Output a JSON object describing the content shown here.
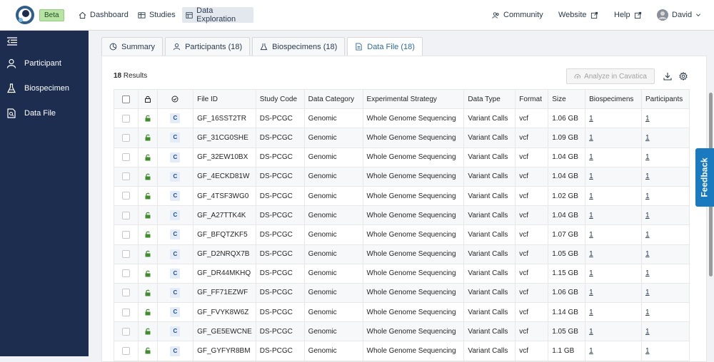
{
  "header": {
    "beta": "Beta",
    "nav": [
      {
        "label": "Dashboard"
      },
      {
        "label": "Studies"
      },
      {
        "label": "Data Exploration"
      }
    ],
    "right": {
      "community": "Community",
      "website": "Website",
      "help": "Help",
      "user": "David"
    }
  },
  "sidebar": {
    "items": [
      {
        "label": "Participant"
      },
      {
        "label": "Biospecimen"
      },
      {
        "label": "Data File"
      }
    ]
  },
  "tabs": [
    {
      "label": "Summary"
    },
    {
      "label": "Participants (18)"
    },
    {
      "label": "Biospecimens (18)"
    },
    {
      "label": "Data File (18)"
    }
  ],
  "toolbar": {
    "results_count": "18",
    "results_label": " Results",
    "cavatica": "Analyze in Cavatica"
  },
  "table": {
    "columns": [
      "File ID",
      "Study Code",
      "Data Category",
      "Experimental Strategy",
      "Data Type",
      "Format",
      "Size",
      "Biospecimens",
      "Participants"
    ],
    "rows": [
      {
        "id": "GF_16SST2TR",
        "study": "DS-PCGC",
        "cat": "Genomic",
        "strategy": "Whole Genome Sequencing",
        "type": "Variant Calls",
        "format": "vcf",
        "size": "1.06 GB",
        "bio": "1",
        "part": "1"
      },
      {
        "id": "GF_31CG0SHE",
        "study": "DS-PCGC",
        "cat": "Genomic",
        "strategy": "Whole Genome Sequencing",
        "type": "Variant Calls",
        "format": "vcf",
        "size": "1.09 GB",
        "bio": "1",
        "part": "1"
      },
      {
        "id": "GF_32EW10BX",
        "study": "DS-PCGC",
        "cat": "Genomic",
        "strategy": "Whole Genome Sequencing",
        "type": "Variant Calls",
        "format": "vcf",
        "size": "1.04 GB",
        "bio": "1",
        "part": "1"
      },
      {
        "id": "GF_4ECKD81W",
        "study": "DS-PCGC",
        "cat": "Genomic",
        "strategy": "Whole Genome Sequencing",
        "type": "Variant Calls",
        "format": "vcf",
        "size": "1.04 GB",
        "bio": "1",
        "part": "1"
      },
      {
        "id": "GF_4TSF3WG0",
        "study": "DS-PCGC",
        "cat": "Genomic",
        "strategy": "Whole Genome Sequencing",
        "type": "Variant Calls",
        "format": "vcf",
        "size": "1.02 GB",
        "bio": "1",
        "part": "1"
      },
      {
        "id": "GF_A27TTK4K",
        "study": "DS-PCGC",
        "cat": "Genomic",
        "strategy": "Whole Genome Sequencing",
        "type": "Variant Calls",
        "format": "vcf",
        "size": "1.04 GB",
        "bio": "1",
        "part": "1"
      },
      {
        "id": "GF_BFQTZKF5",
        "study": "DS-PCGC",
        "cat": "Genomic",
        "strategy": "Whole Genome Sequencing",
        "type": "Variant Calls",
        "format": "vcf",
        "size": "1.07 GB",
        "bio": "1",
        "part": "1"
      },
      {
        "id": "GF_D2NRQX7B",
        "study": "DS-PCGC",
        "cat": "Genomic",
        "strategy": "Whole Genome Sequencing",
        "type": "Variant Calls",
        "format": "vcf",
        "size": "1.05 GB",
        "bio": "1",
        "part": "1"
      },
      {
        "id": "GF_DR44MKHQ",
        "study": "DS-PCGC",
        "cat": "Genomic",
        "strategy": "Whole Genome Sequencing",
        "type": "Variant Calls",
        "format": "vcf",
        "size": "1.15 GB",
        "bio": "1",
        "part": "1"
      },
      {
        "id": "GF_FF71EZWF",
        "study": "DS-PCGC",
        "cat": "Genomic",
        "strategy": "Whole Genome Sequencing",
        "type": "Variant Calls",
        "format": "vcf",
        "size": "1.06 GB",
        "bio": "1",
        "part": "1"
      },
      {
        "id": "GF_FVYK8W6Z",
        "study": "DS-PCGC",
        "cat": "Genomic",
        "strategy": "Whole Genome Sequencing",
        "type": "Variant Calls",
        "format": "vcf",
        "size": "1.14 GB",
        "bio": "1",
        "part": "1"
      },
      {
        "id": "GF_GE5EWCNE",
        "study": "DS-PCGC",
        "cat": "Genomic",
        "strategy": "Whole Genome Sequencing",
        "type": "Variant Calls",
        "format": "vcf",
        "size": "1.05 GB",
        "bio": "1",
        "part": "1"
      },
      {
        "id": "GF_GYFYR8BM",
        "study": "DS-PCGC",
        "cat": "Genomic",
        "strategy": "Whole Genome Sequencing",
        "type": "Variant Calls",
        "format": "vcf",
        "size": "1.1 GB",
        "bio": "1",
        "part": "1"
      }
    ],
    "consent_badge": "C"
  },
  "feedback": "Feedback"
}
